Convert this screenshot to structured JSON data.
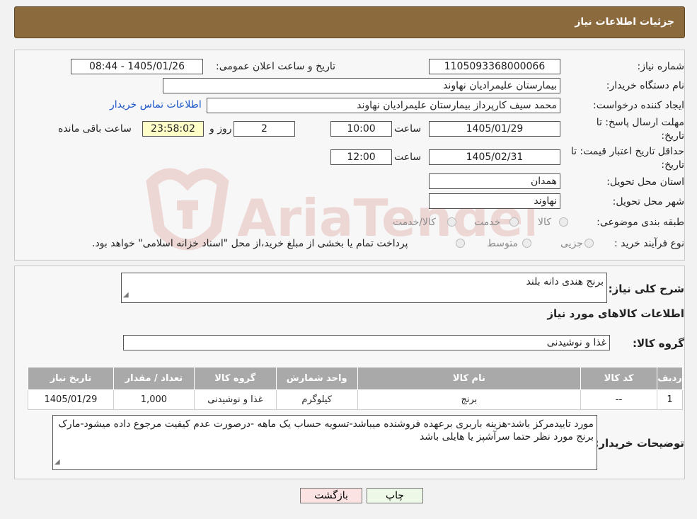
{
  "header": {
    "title": "جزئیات اطلاعات نیاز"
  },
  "watermark": {
    "text": "AriaTender.neT"
  },
  "details": {
    "need_number_label": "شماره نیاز:",
    "need_number": "1105093368000066",
    "announce_label": "تاریخ و ساعت اعلان عمومی:",
    "announce_value": "1405/01/26 - 08:44",
    "buyer_org_label": "نام دستگاه خریدار:",
    "buyer_org": "بیمارستان علیمرادیان نهاوند",
    "requester_label": "ایجاد کننده درخواست:",
    "requester": "محمد سیف کارپرداز بیمارستان علیمرادیان نهاوند",
    "contact_link": "اطلاعات تماس خریدار",
    "reply_deadline_label_1": "مهلت ارسال پاسخ: تا",
    "reply_deadline_label_2": "تاریخ:",
    "reply_date": "1405/01/29",
    "time_label": "ساعت",
    "reply_time": "10:00",
    "days_value": "2",
    "days_label": "روز و",
    "remaining_time": "23:58:02",
    "remaining_label": "ساعت باقی مانده",
    "price_validity_label_1": "حداقل تاریخ اعتبار قیمت: تا",
    "price_validity_label_2": "تاریخ:",
    "price_validity_date": "1405/02/31",
    "price_validity_time": "12:00",
    "province_label": "استان محل تحویل:",
    "province": "همدان",
    "city_label": "شهر محل تحویل:",
    "city": "نهاوند",
    "category_label": "طبقه بندی موضوعی:",
    "category_options": [
      "کالا",
      "خدمت",
      "کالا/خدمت"
    ],
    "process_label": "نوع فرآیند خرید :",
    "process_options": [
      "جزیی",
      "متوسط"
    ],
    "process_note": "پرداخت تمام یا بخشی از مبلغ خرید،از محل \"اسناد خزانه اسلامی\" خواهد بود."
  },
  "summary": {
    "description_label": "شرح کلی نیاز:",
    "description": "برنج هندی دانه بلند",
    "goods_info_title": "اطلاعات کالاهای مورد نیاز",
    "goods_group_label": "گروه کالا:",
    "goods_group": "غذا و نوشیدنی"
  },
  "table": {
    "headers": [
      "ردیف",
      "کد کالا",
      "نام کالا",
      "واحد شمارش",
      "گروه کالا",
      "تعداد / مقدار",
      "تاریخ نیاز"
    ],
    "rows": [
      [
        "1",
        "--",
        "برنج",
        "کیلوگرم",
        "غذا و نوشیدنی",
        "1,000",
        "1405/01/29"
      ]
    ]
  },
  "buyer_notes": {
    "label": "توضیحات خریدار:",
    "text": "مورد تاییدمرکز باشد-هزینه باربری برعهده فروشنده میباشد-تسویه حساب یک ماهه -درصورت عدم کیفیت مرجوع داده میشود-مارک برنج مورد نظر حتما سرآشپز یا هایلی باشد"
  },
  "buttons": {
    "print": "چاپ",
    "back": "بازگشت"
  }
}
